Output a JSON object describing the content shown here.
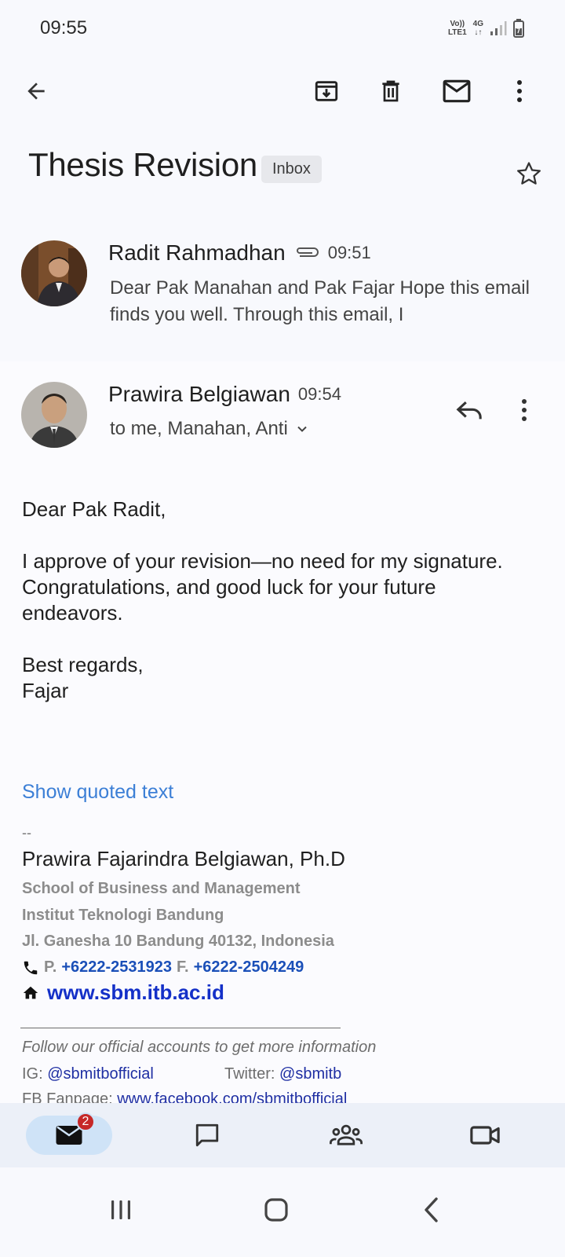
{
  "status_bar": {
    "time": "09:55",
    "network_top": "Vo))",
    "network_bottom": "LTE1",
    "signal_type": "4G",
    "icons": [
      "volte-icon",
      "data-arrows-icon",
      "signal-icon",
      "battery-icon"
    ]
  },
  "toolbar": {
    "icons": [
      "back-arrow-icon",
      "archive-icon",
      "delete-icon",
      "mark-unread-icon",
      "more-vert-icon"
    ]
  },
  "email": {
    "subject": "Thesis Revision",
    "label": "Inbox",
    "starred": false
  },
  "messages": [
    {
      "sender": "Radit Rahmadhan",
      "has_attachment": true,
      "time": "09:51",
      "snippet": "Dear Pak Manahan and Pak Fajar Hope this email finds you well. Through this email, I"
    },
    {
      "sender": "Prawira Belgiawan",
      "time": "09:54",
      "recipients": "to me, Manahan, Anti",
      "body": {
        "greeting": "Dear Pak Radit,",
        "line1": "I approve of your revision—no need for my signature.",
        "line2": "Congratulations, and good luck for your future endeavors.",
        "closing": "Best regards,",
        "name": "Fajar"
      },
      "show_quoted": "Show quoted text",
      "signature": {
        "dashes": "--",
        "name": "Prawira Fajarindra Belgiawan, Ph.D",
        "school": "School of Business and Management",
        "institute": "Institut Teknologi Bandung",
        "address": "Jl. Ganesha 10 Bandung 40132, Indonesia",
        "phone_label": "P.",
        "phone": "+6222-2531923",
        "fax_label": "F.",
        "fax": "+6222-2504249",
        "website": "www.sbm.itb.ac.id",
        "follow_text": "Follow our official accounts to get more information",
        "ig_label": "IG:",
        "ig_handle": "@sbmitbofficial",
        "twitter_label": "Twitter:",
        "twitter_handle": "@sbmitb",
        "fb_label": "FB Fanpage:",
        "fb_link": "www.facebook.com/sbmitbofficial"
      }
    }
  ],
  "bottom_nav": {
    "mail_badge": "2",
    "items": [
      "mail-icon",
      "chat-icon",
      "spaces-icon",
      "meet-icon"
    ],
    "active": "mail-icon"
  },
  "colors": {
    "link_blue": "#3c7fd6",
    "active_nav": "#cfe3f7",
    "badge_red": "#c62828"
  }
}
